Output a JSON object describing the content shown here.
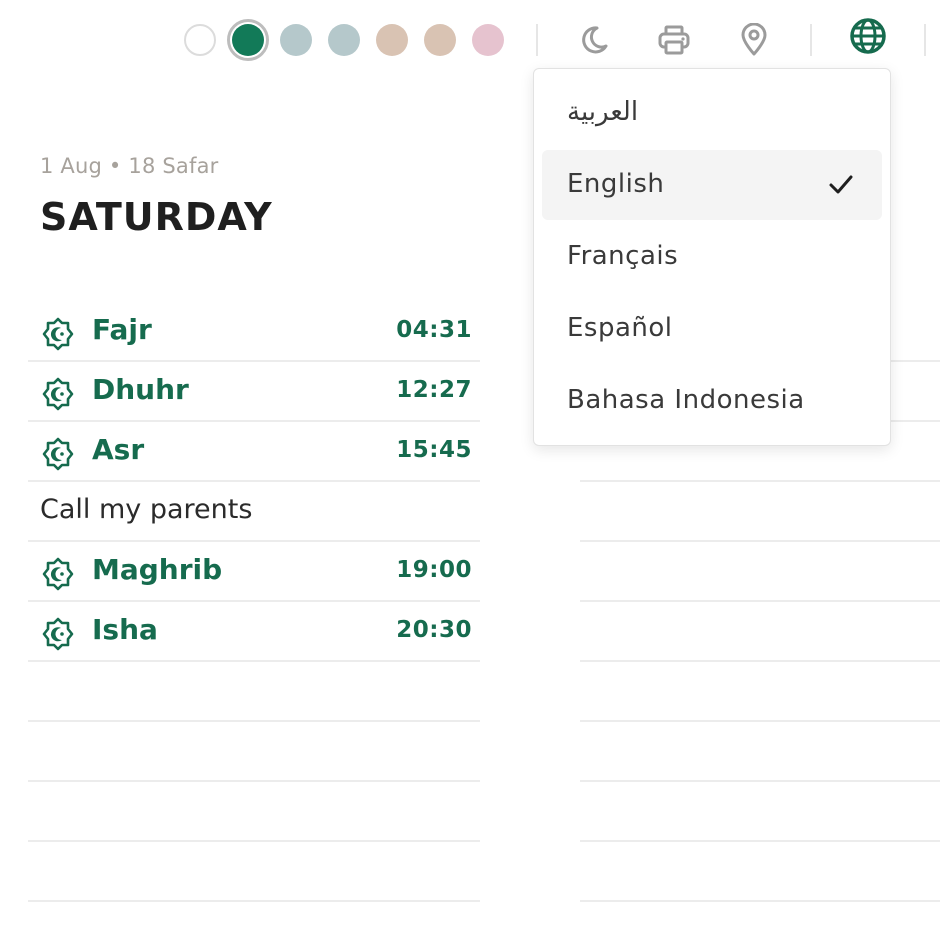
{
  "toolbar": {
    "swatches": [
      {
        "name": "white",
        "color": "#ffffff"
      },
      {
        "name": "green",
        "color": "#127a58",
        "selected": true
      },
      {
        "name": "blue-grey",
        "color": "#b5c8cb"
      },
      {
        "name": "blue-grey-2",
        "color": "#b5c8cb"
      },
      {
        "name": "sand",
        "color": "#d9c3b3"
      },
      {
        "name": "sand-2",
        "color": "#d9c3b3"
      },
      {
        "name": "pink",
        "color": "#e6c3cf"
      }
    ],
    "icons": [
      "moon-icon",
      "printer-icon",
      "location-pin-icon",
      "globe-icon"
    ]
  },
  "header": {
    "date_line": "1 Aug • 18 Safar",
    "day": "SATURDAY"
  },
  "prayers": [
    {
      "name": "Fajr",
      "time": "04:31"
    },
    {
      "name": "Dhuhr",
      "time": "12:27"
    },
    {
      "name": "Asr",
      "time": "15:45"
    },
    {
      "note": "Call my parents"
    },
    {
      "name": "Maghrib",
      "time": "19:00"
    },
    {
      "name": "Isha",
      "time": "20:30"
    }
  ],
  "language_menu": {
    "items": [
      "العربية",
      "English",
      "Français",
      "Español",
      "Bahasa Indonesia"
    ],
    "selected": "English"
  },
  "colors": {
    "accent": "#166b4e",
    "muted_text": "#a7a29c",
    "icon_grey": "#9b9b9b"
  }
}
